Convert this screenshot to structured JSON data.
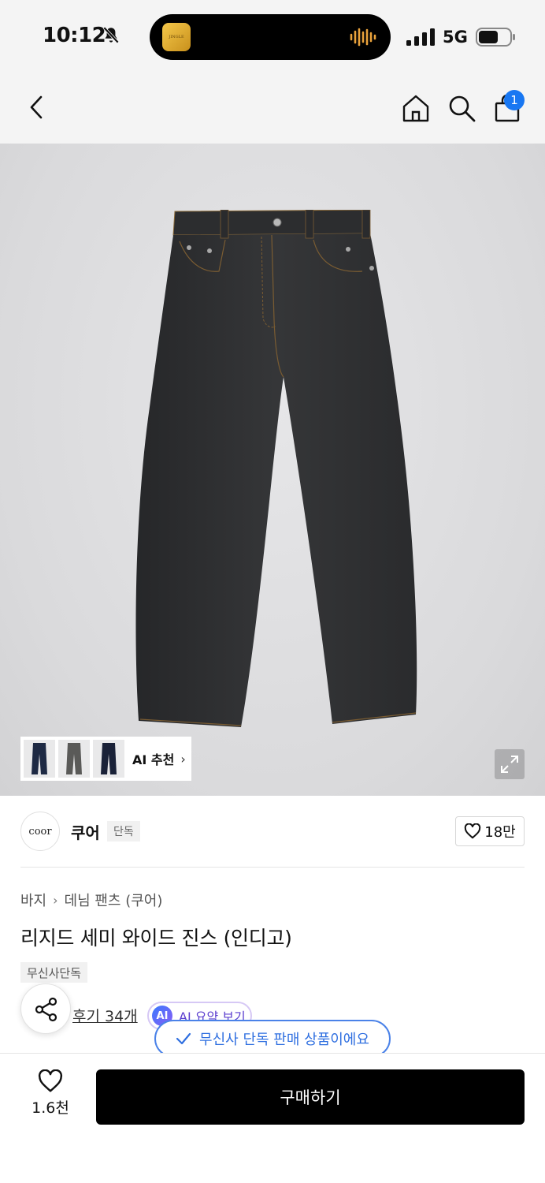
{
  "status_bar": {
    "time": "10:12",
    "network": "5G",
    "island_app_text": "JINGLE"
  },
  "nav": {
    "cart_count": "1"
  },
  "hero": {
    "ai_reco_label": "AI 추천",
    "ai_reco_chevron": "›"
  },
  "brand": {
    "logo_text": "coor",
    "name": "쿠어",
    "tag": "단독",
    "likes": "18만"
  },
  "product": {
    "breadcrumb": [
      "바지",
      "데님 팬츠 (쿠어)"
    ],
    "breadcrumb_sep": "›",
    "title": "리지드 세미 와이드 진스 (인디고)",
    "exclusive_tag": "무신사단독",
    "reviews": "후기 34개",
    "ai_summary_icon": "AI",
    "ai_summary_label": "AI 요약 보기"
  },
  "toast": {
    "text": "무신사 단독 판매 상품이에요"
  },
  "bottom_bar": {
    "wish_count": "1.6천",
    "buy_label": "구매하기"
  },
  "colors": {
    "accent_blue": "#1877f2",
    "toast_blue": "#2f6fe0",
    "ai_purple": "#5b3ecf",
    "buy_button": "#000000",
    "denim": "#2e2f31"
  }
}
